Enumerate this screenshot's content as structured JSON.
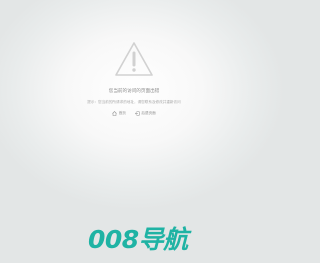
{
  "error": {
    "icon": "warning-triangle-icon",
    "title": "您当前的访问的页面出错",
    "hint": "提示：您当前的所请求的地址，请您联系及修改并重新访问"
  },
  "actions": {
    "home": {
      "icon": "home-icon",
      "label": "首页"
    },
    "back": {
      "icon": "back-icon",
      "label": "后退页面"
    }
  },
  "brand": {
    "logo_text": "008导航",
    "color": "#1fb3a4"
  },
  "colors": {
    "title": "#8a8a8a",
    "hint": "#ababab",
    "icon": "#cfcfcf"
  }
}
